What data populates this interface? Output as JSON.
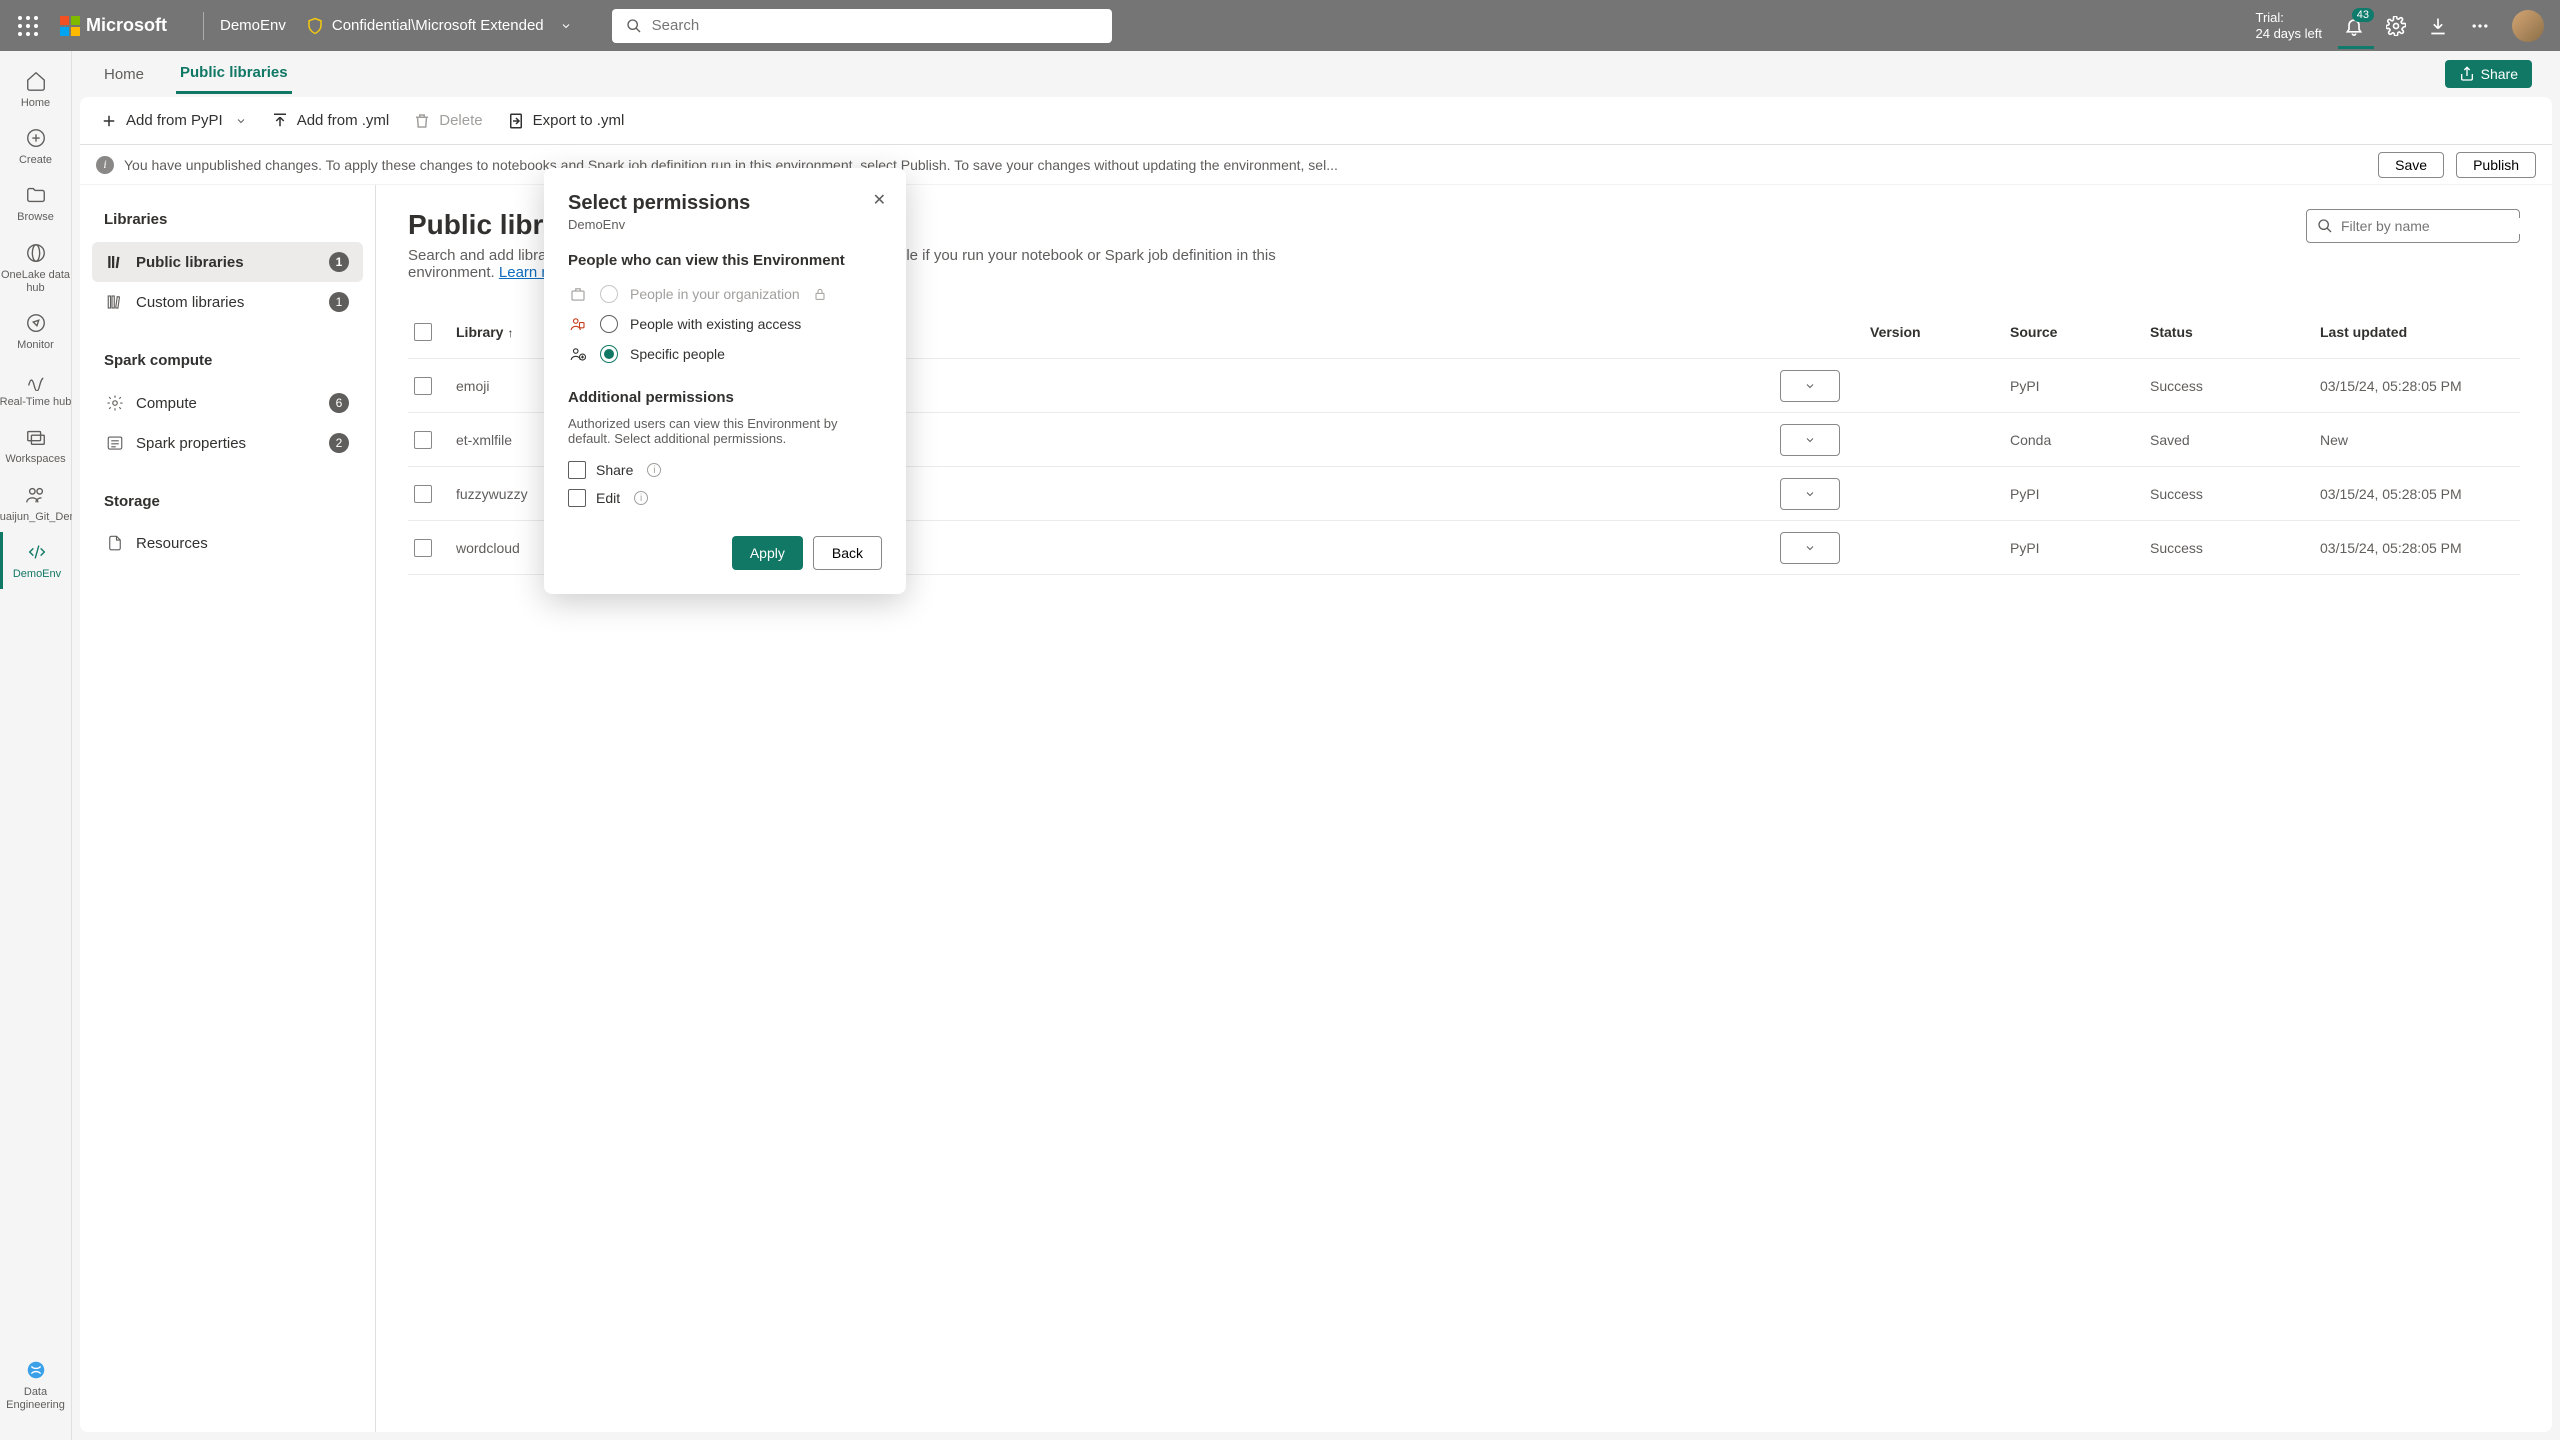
{
  "topbar": {
    "brand": "Microsoft",
    "env": "DemoEnv",
    "sensitivity": "Confidential\\Microsoft Extended",
    "search_placeholder": "Search",
    "trial_line1": "Trial:",
    "trial_line2": "24 days left",
    "notif_count": "43"
  },
  "rail": {
    "items": [
      {
        "label": "Home"
      },
      {
        "label": "Create"
      },
      {
        "label": "Browse"
      },
      {
        "label": "OneLake data hub"
      },
      {
        "label": "Monitor"
      },
      {
        "label": "Real-Time hub"
      },
      {
        "label": "Workspaces"
      },
      {
        "label": "Shuaijun_Git_Demo"
      },
      {
        "label": "DemoEnv"
      }
    ],
    "bottom": {
      "label": "Data Engineering"
    }
  },
  "tabs": {
    "home": "Home",
    "public": "Public libraries",
    "share": "Share"
  },
  "toolbar": {
    "add_pypi": "Add from PyPI",
    "add_yml": "Add from .yml",
    "delete": "Delete",
    "export": "Export to .yml"
  },
  "infobar": {
    "text": "You have unpublished changes. To apply these changes to notebooks and Spark job definition run in this environment, select Publish. To save your changes without updating the environment, sel...",
    "save": "Save",
    "publish": "Publish"
  },
  "sidebar": {
    "libraries_h": "Libraries",
    "public": {
      "label": "Public libraries",
      "badge": "1"
    },
    "custom": {
      "label": "Custom libraries",
      "badge": "1"
    },
    "spark_h": "Spark compute",
    "compute": {
      "label": "Compute",
      "badge": "6"
    },
    "props": {
      "label": "Spark properties",
      "badge": "2"
    },
    "storage_h": "Storage",
    "resources": {
      "label": "Resources"
    }
  },
  "detail": {
    "title": "Public libraries",
    "desc_a": "Search and add libraries from PyPI and Conda. The libraries will be available if you run your notebook or Spark job definition in this environment. ",
    "learn": "Learn more",
    "filter_placeholder": "Filter by name",
    "cols": {
      "library": "Library",
      "version": "Version",
      "source": "Source",
      "status": "Status",
      "updated": "Last updated"
    },
    "rows": [
      {
        "lib": "emoji",
        "source": "PyPI",
        "status": "Success",
        "updated": "03/15/24, 05:28:05 PM"
      },
      {
        "lib": "et-xmlfile",
        "source": "Conda",
        "status": "Saved",
        "updated": "New"
      },
      {
        "lib": "fuzzywuzzy",
        "source": "PyPI",
        "status": "Success",
        "updated": "03/15/24, 05:28:05 PM"
      },
      {
        "lib": "wordcloud",
        "source": "PyPI",
        "status": "Success",
        "updated": "03/15/24, 05:28:05 PM"
      }
    ]
  },
  "dialog": {
    "title": "Select permissions",
    "sub": "DemoEnv",
    "view_h": "People who can view this Environment",
    "opt_org": "People in your organization",
    "opt_existing": "People with existing access",
    "opt_specific": "Specific people",
    "addl_h": "Additional permissions",
    "addl_desc": "Authorized users can view this Environment by default. Select additional permissions.",
    "share": "Share",
    "edit": "Edit",
    "apply": "Apply",
    "back": "Back"
  }
}
